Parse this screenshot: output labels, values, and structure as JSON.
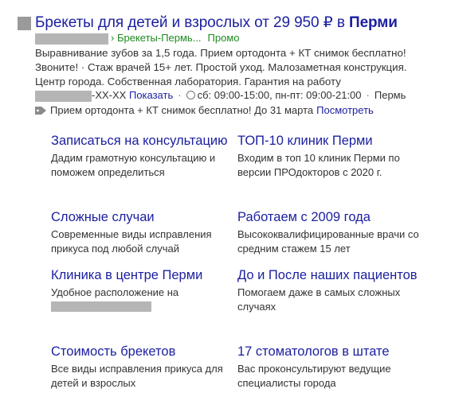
{
  "ad": {
    "title_main": "Брекеты для детей и взрослых от 29 950 ₽ в ",
    "title_city": "Перми",
    "url_path": "› Брекеты-Пермь...",
    "promo_label": "Промо",
    "description": "Выравнивание зубов за 1,5 года. Прием ортодонта + КТ снимок бесплатно! Звоните! · Стаж врачей 15+ лет. Простой уход. Малозаметная конструкция. Центр города. Собственная лаборатория. Гарантия на работу",
    "phone_suffix": "-XX-XX",
    "phone_show": "Показать",
    "hours": "сб: 09:00-15:00, пн-пт: 09:00-21:00",
    "city": "Пермь",
    "offer_text": "Прием ортодонта + КТ снимок бесплатно! До 31 марта",
    "offer_more": "Посмотреть"
  },
  "sitelinks": [
    {
      "title": "Записаться на консультацию",
      "desc": "Дадим грамотную консультацию и поможем определиться"
    },
    {
      "title": "ТОП-10 клиник Перми",
      "desc": "Входим в топ 10 клиник Перми по версии ПРОдокторов с 2020 г."
    },
    {
      "title": "Сложные случаи",
      "desc": "Современные виды исправления прикуса под любой случай"
    },
    {
      "title": "Работаем с 2009 года",
      "desc": "Высококвалифицированные врачи со средним стажем 15 лет"
    },
    {
      "title": "Клиника в центре Перми",
      "desc": "Удобное расположение на"
    },
    {
      "title": "До и После наших пациентов",
      "desc": "Помогаем даже в самых сложных случаях"
    },
    {
      "title": "Стоимость брекетов",
      "desc": "Все виды исправления прикуса для детей и взрослых"
    },
    {
      "title": "17 стоматологов в штате",
      "desc": "Вас проконсультируют ведущие специалисты города"
    }
  ],
  "colors": {
    "link": "#1b1f9f",
    "green": "#1f8a1f",
    "text": "#333333"
  }
}
